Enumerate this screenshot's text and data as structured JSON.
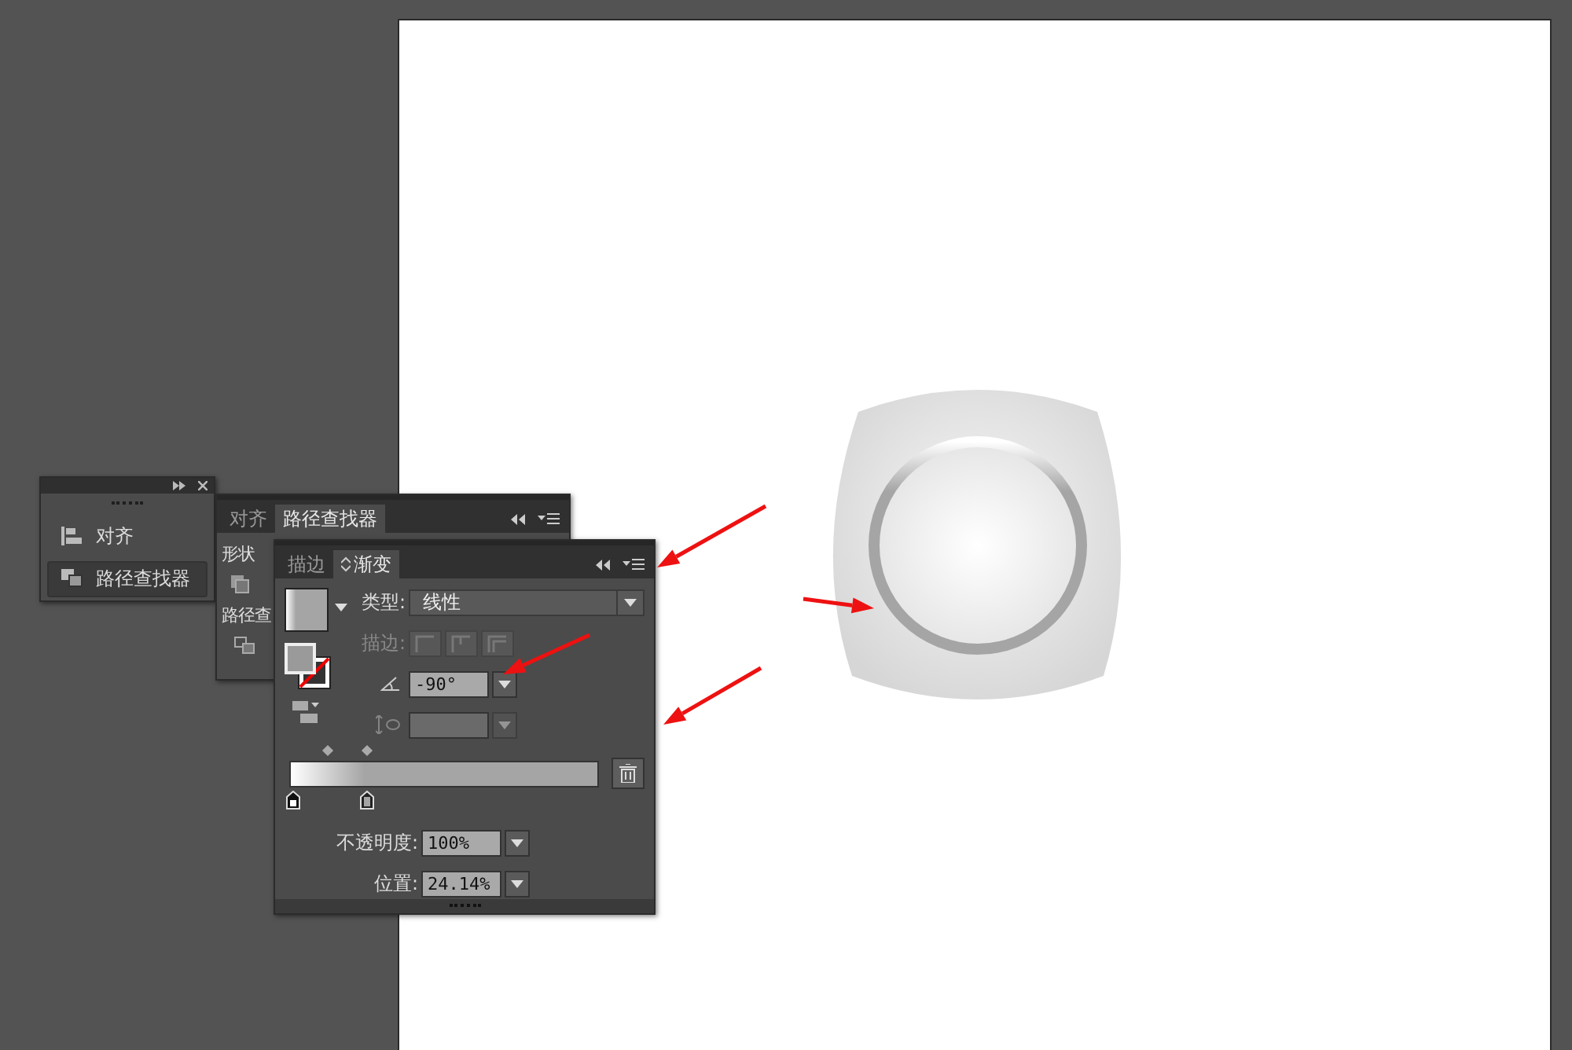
{
  "tools_panel": {
    "items": [
      {
        "label": "对齐",
        "selected": false
      },
      {
        "label": "路径查找器",
        "selected": true
      }
    ]
  },
  "pathfinder_panel": {
    "tabs": [
      {
        "label": "对齐",
        "selected": false
      },
      {
        "label": "路径查找器",
        "selected": true
      }
    ],
    "section_1": "形状",
    "section_2": "路径查"
  },
  "gradient_panel": {
    "tabs": [
      {
        "label": "描边",
        "selected": false
      },
      {
        "label": "渐变",
        "selected": true
      }
    ],
    "type_label": "类型:",
    "type_value": "线性",
    "stroke_label": "描边:",
    "stroke_disabled": true,
    "angle_value": "-90°",
    "aspect_disabled": true,
    "stops": [
      {
        "selected": false
      },
      {
        "selected": true
      }
    ],
    "opacity_label": "不透明度:",
    "opacity_value": "100%",
    "position_label": "位置:",
    "position_value": "24.14%"
  }
}
